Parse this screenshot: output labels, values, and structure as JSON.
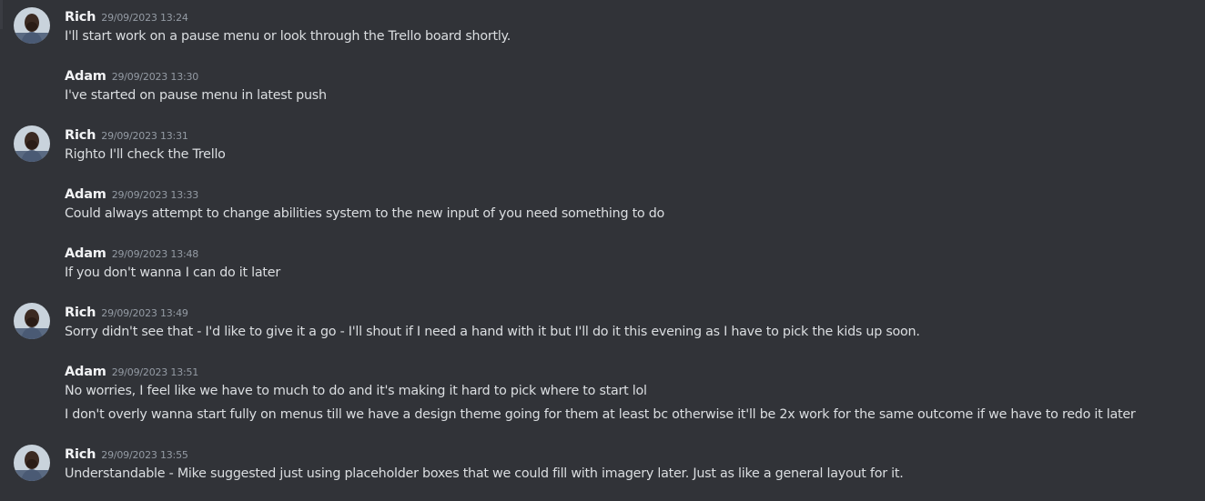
{
  "colors": {
    "background": "#313338",
    "author": "#f2f3f5",
    "timestamp": "#949ba4",
    "text": "#dbdee1"
  },
  "messages": [
    {
      "author": "Rich",
      "timestamp": "29/09/2023 13:24",
      "has_avatar": true,
      "lines": [
        "I'll start work on a pause menu or look through the Trello board shortly."
      ]
    },
    {
      "author": "Adam",
      "timestamp": "29/09/2023 13:30",
      "has_avatar": false,
      "lines": [
        "I've started on pause menu in latest push"
      ]
    },
    {
      "author": "Rich",
      "timestamp": "29/09/2023 13:31",
      "has_avatar": true,
      "lines": [
        "Righto I'll check the Trello"
      ]
    },
    {
      "author": "Adam",
      "timestamp": "29/09/2023 13:33",
      "has_avatar": false,
      "lines": [
        "Could always attempt to change abilities system to the new input of you need something to do"
      ]
    },
    {
      "author": "Adam",
      "timestamp": "29/09/2023 13:48",
      "has_avatar": false,
      "lines": [
        "If you don't wanna I can do it later"
      ]
    },
    {
      "author": "Rich",
      "timestamp": "29/09/2023 13:49",
      "has_avatar": true,
      "lines": [
        "Sorry didn't see that - I'd like to give it a go - I'll shout if I need a hand with it but I'll do it this evening as I have to pick the kids up soon."
      ]
    },
    {
      "author": "Adam",
      "timestamp": "29/09/2023 13:51",
      "has_avatar": false,
      "lines": [
        "No worries, I feel like we have to much to do and it's making it hard to pick where to start lol",
        "I don't overly wanna start fully on menus till we have a design theme going for them at least bc otherwise it'll be 2x work for the same outcome if we have to redo it later"
      ]
    },
    {
      "author": "Rich",
      "timestamp": "29/09/2023 13:55",
      "has_avatar": true,
      "lines": [
        "Understandable - Mike suggested just using placeholder boxes that we could fill with imagery later. Just as like a general layout for it."
      ]
    }
  ]
}
